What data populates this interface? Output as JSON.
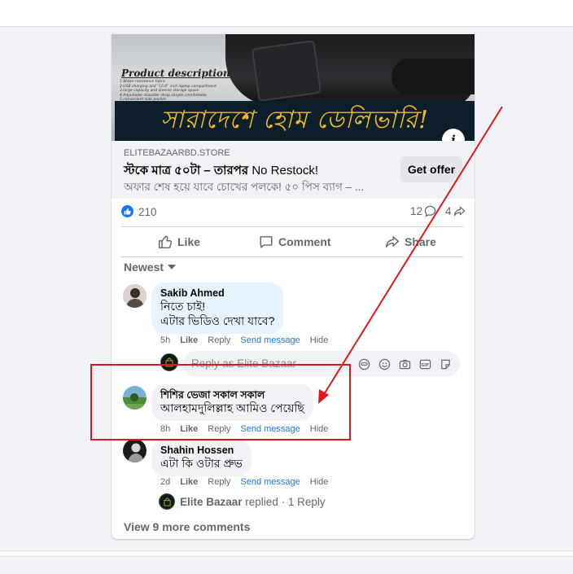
{
  "ad": {
    "image_title": "Product description",
    "image_features": [
      "1.Water-resistance fabric",
      "2.USB charging and \"15.6\" inch laptop compartment",
      "3.large capacity and diverse storage space",
      "4.Adjustable shoulder strap,simple,comfortable",
      "5.convenient side pocket"
    ],
    "banner_text": "সারাদেশে হোম ডেলিভারি!",
    "domain": "ELITEBAZAARBD.STORE",
    "headline_bold": "স্টকে মাত্র ৫০টা – তারপর",
    "headline_rest": " No Restock!",
    "subtext": "অফার শেষ হয়ে যাবে চোখের পলকে! ৫০ পিস ব্যাগ – ...",
    "cta_label": "Get offer",
    "info_icon": "i"
  },
  "stats": {
    "likes": "210",
    "comments": "12",
    "shares": "4"
  },
  "actions": {
    "like": "Like",
    "comment": "Comment",
    "share": "Share"
  },
  "sort_label": "Newest",
  "comments": [
    {
      "author": "Sakib Ahmed",
      "lines": [
        "নিতে চাই!",
        "এটার ভিডিও দেখা যাবে?"
      ],
      "time": "5h",
      "like": "Like",
      "reply": "Reply",
      "send": "Send message",
      "hide": "Hide"
    },
    {
      "author": "শিশির ভেজা সকাল সকাল",
      "lines": [
        "আলহামদুলিল্লাহ আমিও পেয়েছি"
      ],
      "time": "8h",
      "like": "Like",
      "reply": "Reply",
      "send": "Send message",
      "hide": "Hide"
    },
    {
      "author": "Shahin Hossen",
      "lines": [
        "এটা কি ওটার প্রুভ"
      ],
      "time": "2d",
      "like": "Like",
      "reply": "Reply",
      "send": "Send message",
      "hide": "Hide"
    }
  ],
  "reply_box": {
    "placeholder": "Reply as Elite Bazaar"
  },
  "replied": {
    "name": "Elite Bazaar",
    "text": " replied · 1 Reply"
  },
  "view_more": "View 9 more comments",
  "colors": {
    "accent": "#1877f2",
    "annotation": "#e0181c",
    "banner_text": "#f2b825"
  }
}
